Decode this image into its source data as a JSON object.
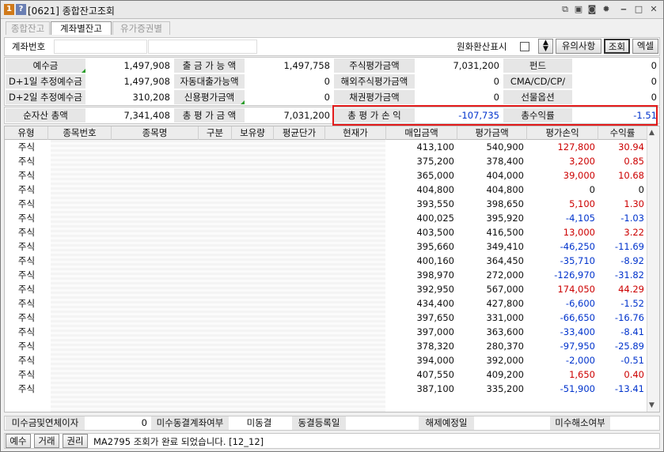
{
  "window": {
    "title": "[0621] 종합잔고조회",
    "icon1": "1",
    "icon2": "?",
    "icons": [
      "copy-icon",
      "lock-icon",
      "camera-icon",
      "gear-icon",
      "minimize-icon",
      "maximize-icon",
      "close-icon"
    ],
    "accent": "#e31b1b"
  },
  "tabs": [
    "종합잔고",
    "계좌별잔고",
    "유가증권별"
  ],
  "account": {
    "label": "계좌번호",
    "fx_label": "원화환산표시",
    "caution_btn": "유의사항",
    "query_btn": "조회",
    "excel_btn": "엑셀"
  },
  "summary": {
    "rows": [
      [
        "예수금",
        "1,497,908",
        "출 금 가 능 액",
        "1,497,758",
        "주식평가금액",
        "7,031,200",
        "펀드",
        "0"
      ],
      [
        "D+1일 추정예수금",
        "1,497,908",
        "자동대출가능액",
        "0",
        "해외주식평가금액",
        "0",
        "CMA/CD/CP/",
        "0"
      ],
      [
        "D+2일 추정예수금",
        "310,208",
        "신용평가금액",
        "0",
        "채권평가금액",
        "0",
        "선물옵션",
        "0"
      ]
    ],
    "totals": [
      "순자산 총액",
      "7,341,408",
      "총 평 가 금 액",
      "7,031,200",
      "총 평 가 손 익",
      "-107,735",
      "총수익률",
      "-1.51"
    ]
  },
  "grid": {
    "headers": [
      "유형",
      "종목번호",
      "종목명",
      "구분",
      "보유량",
      "평균단가",
      "현재가",
      "매입금액",
      "평가금액",
      "평가손익",
      "수익률"
    ],
    "rows": [
      [
        "주식",
        "413,100",
        "540,900",
        "127,800",
        "30.94"
      ],
      [
        "주식",
        "375,200",
        "378,400",
        "3,200",
        "0.85"
      ],
      [
        "주식",
        "365,000",
        "404,000",
        "39,000",
        "10.68"
      ],
      [
        "주식",
        "404,800",
        "404,800",
        "0",
        "0"
      ],
      [
        "주식",
        "393,550",
        "398,650",
        "5,100",
        "1.30"
      ],
      [
        "주식",
        "400,025",
        "395,920",
        "-4,105",
        "-1.03"
      ],
      [
        "주식",
        "403,500",
        "416,500",
        "13,000",
        "3.22"
      ],
      [
        "주식",
        "395,660",
        "349,410",
        "-46,250",
        "-11.69"
      ],
      [
        "주식",
        "400,160",
        "364,450",
        "-35,710",
        "-8.92"
      ],
      [
        "주식",
        "398,970",
        "272,000",
        "-126,970",
        "-31.82"
      ],
      [
        "주식",
        "392,950",
        "567,000",
        "174,050",
        "44.29"
      ],
      [
        "주식",
        "434,400",
        "427,800",
        "-6,600",
        "-1.52"
      ],
      [
        "주식",
        "397,650",
        "331,000",
        "-66,650",
        "-16.76"
      ],
      [
        "주식",
        "397,000",
        "363,600",
        "-33,400",
        "-8.41"
      ],
      [
        "주식",
        "378,320",
        "280,370",
        "-97,950",
        "-25.89"
      ],
      [
        "주식",
        "394,000",
        "392,000",
        "-2,000",
        "-0.51"
      ],
      [
        "주식",
        "407,550",
        "409,200",
        "1,650",
        "0.40"
      ],
      [
        "주식",
        "387,100",
        "335,200",
        "-51,900",
        "-13.41"
      ]
    ]
  },
  "footer": {
    "f1": "미수금및연체이자",
    "f1_val": "0",
    "f2": "미수동결계좌여부",
    "f3": "미동결",
    "f4": "동결등록일",
    "f5": "해제예정일",
    "f6": "미수해소여부"
  },
  "status": {
    "btn1": "예수",
    "btn2": "거래",
    "btn3": "권리",
    "message": "MA2795 조회가 완료 되었습니다. [12_12]"
  },
  "colors": {
    "positive": "#cc0000",
    "negative": "#0033cc"
  }
}
